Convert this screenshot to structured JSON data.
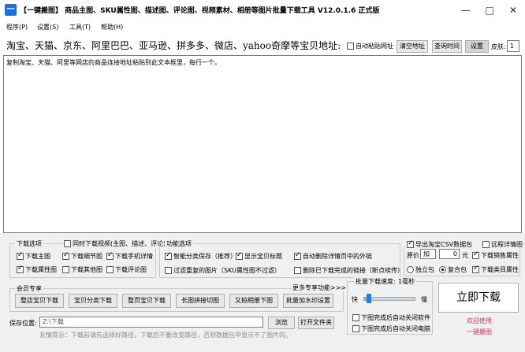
{
  "window": {
    "app_icon_text": "一",
    "title": "【一键搬图】 商品主图、SKU属性图、描述图、评论图、视频素材、相册等图片批量下载工具 V12.0.1.6 正式版",
    "minimize_glyph": "—",
    "maximize_glyph": "□",
    "close_glyph": "✕"
  },
  "menu": [
    "程序(P)",
    "设置(S)",
    "工具(T)",
    "帮助(H)"
  ],
  "url_row": {
    "label": "淘宝、天猫、京东、阿里巴巴、亚马逊、拼多多、微店、yahoo奇摩等宝贝地址:",
    "auto_paste_label": "自动粘贴网址",
    "auto_paste_checked": false,
    "clear_button": "清空地址",
    "query_time_button": "查询时间",
    "settings_button": "设置",
    "skin_label": "皮肤:",
    "skin_value": "1"
  },
  "textarea": {
    "hint": "复制淘宝、天猫、阿里等网店的商品连接地址粘贴到此文本框里，每行一个。"
  },
  "download_options": {
    "title": "下载选项",
    "with_video_label": "同时下载视频(主图、描述、评论)",
    "with_video_checked": false,
    "items": [
      {
        "label": "下载主图",
        "checked": true
      },
      {
        "label": "下载细节图",
        "checked": true
      },
      {
        "label": "下载手机详情",
        "checked": true
      },
      {
        "label": "下载属性图",
        "checked": true
      },
      {
        "label": "下载其他图",
        "checked": false
      },
      {
        "label": "下载评论图",
        "checked": false
      }
    ]
  },
  "function_options": {
    "title": "功能选项",
    "items": [
      {
        "label": "智能分类保存（推荐）",
        "checked": true
      },
      {
        "label": "显示宝贝标题",
        "checked": true
      },
      {
        "label": "自动删除详情页中的外链",
        "checked": true
      },
      {
        "label": "过滤重复的图片（SKU属性图不过滤）",
        "checked": false
      },
      {
        "label": "删除已下载完成的链接（断点续传）",
        "checked": false
      }
    ]
  },
  "right_options": {
    "export_csv_label": "导出淘宝CSV数据包",
    "export_csv_checked": true,
    "remote_detail_label": "远程详情图",
    "remote_detail_checked": false,
    "price_label": "原价",
    "price_op": "加",
    "price_value": "0",
    "price_unit": "元",
    "sales_attr_label": "下载销售属性",
    "sales_attr_checked": true,
    "single_pack_label": "独立包",
    "single_pack_checked": false,
    "combined_pack_label": "复合包",
    "combined_pack_checked": true,
    "category_attr_label": "下载类目属性",
    "category_attr_checked": true
  },
  "member": {
    "title": "会员专享",
    "more_label": "更多专享功能>>>",
    "buttons": [
      "整店宝贝下载",
      "宝贝分类下载",
      "整页宝贝下载",
      "长图拼接切图",
      "又拍相册下图",
      "批量加水印设置"
    ]
  },
  "speed": {
    "label": "批量下载速度:",
    "value_label": "1毫秒",
    "fast_label": "快",
    "slow_label": "慢",
    "level": 0.05,
    "close_software_label": "下图完成后自动关闭软件",
    "close_software_checked": false,
    "shutdown_label": "下图完成后自动关闭电脑",
    "shutdown_checked": false
  },
  "save": {
    "label": "保存位置:",
    "path": "Z:\\下载",
    "browse_button": "浏览",
    "open_folder_button": "打开文件夹"
  },
  "start_button": "立即下载",
  "welcome_line1": "欢迎使用",
  "welcome_line2": "一键搬图",
  "tip": "友情提示：下载前请先选择好路径，下载后不要改变路径，否则数据包中显示不了图片的。"
}
